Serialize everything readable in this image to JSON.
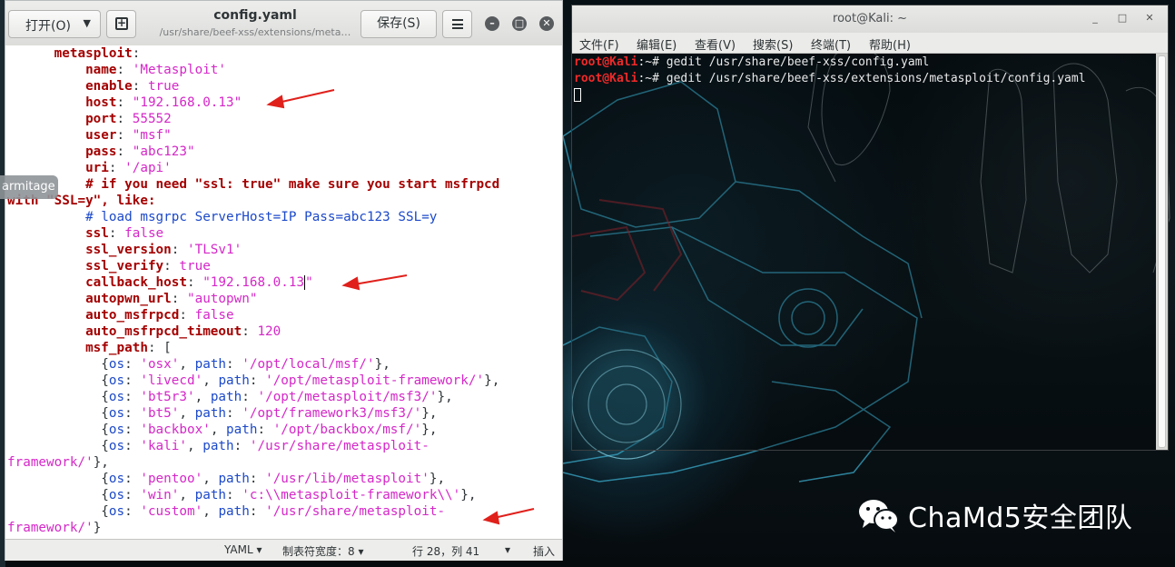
{
  "desktop": {
    "side_tag": "armitage",
    "brand": "ChaMd5安全团队"
  },
  "gedit": {
    "open_label": "打开(O)",
    "title": "config.yaml",
    "subtitle": "/usr/share/beef-xss/extensions/meta…",
    "save_label": "保存(S)",
    "status": {
      "language": "YAML",
      "tab_width": "制表符宽度：8",
      "position": "行 28，列 41",
      "mode": "插入"
    },
    "lines": {
      "l1k": "metasploit",
      "l2k": "name",
      "l2v": "'Metasploit'",
      "l3k": "enable",
      "l3v": "true",
      "l4k": "host",
      "l4v": "\"192.168.0.13\"",
      "l5k": "port",
      "l5v": "55552",
      "l6k": "user",
      "l6v": "\"msf\"",
      "l7k": "pass",
      "l7v": "\"abc123\"",
      "l8k": "uri",
      "l8v": "'/api'",
      "l9": "# if you need \"ssl: true\" make sure you start msfrpcd",
      "l10": "with \"SSL=y\", like:",
      "l11": "# load msgrpc ServerHost=IP Pass=abc123 SSL=y",
      "l12k": "ssl",
      "l12v": "false",
      "l13k": "ssl_version",
      "l13v": "'TLSv1'",
      "l14k": "ssl_verify",
      "l14v": "true",
      "l15k": "callback_host",
      "l15v": "\"192.168.0.13",
      "l15q": "\"",
      "l16k": "autopwn_url",
      "l16v": "\"autopwn\"",
      "l17k": "auto_msfrpcd",
      "l17v": "false",
      "l18k": "auto_msfrpcd_timeout",
      "l18v": "120",
      "l19k": "msf_path",
      "l19v": "[",
      "p1os": "'osx'",
      "p1path": "'/opt/local/msf/'",
      "p2os": "'livecd'",
      "p2path": "'/opt/metasploit-framework/'",
      "p3os": "'bt5r3'",
      "p3path": "'/opt/metasploit/msf3/'",
      "p4os": "'bt5'",
      "p4path": "'/opt/framework3/msf3/'",
      "p5os": "'backbox'",
      "p5path": "'/opt/backbox/msf/'",
      "p6os": "'kali'",
      "p6path": "'/usr/share/metasploit-",
      "p6cont": "framework/'",
      "p7os": "'pentoo'",
      "p7path": "'/usr/lib/metasploit'",
      "p8os": "'win'",
      "p8path": "'c:\\\\metasploit-framework\\\\'",
      "p9os": "'custom'",
      "p9path": "'/usr/share/metasploit-",
      "p9cont": "framework/'",
      "os_key": "os",
      "path_key": "path"
    }
  },
  "terminal": {
    "title": "root@Kali: ~",
    "menu": [
      "文件(F)",
      "编辑(E)",
      "查看(V)",
      "搜索(S)",
      "终端(T)",
      "帮助(H)"
    ],
    "prompt_user": "root@Kali",
    "prompt_rest": ":~# ",
    "cmd1": "gedit /usr/share/beef-xss/config.yaml",
    "cmd2": "gedit /usr/share/beef-xss/extensions/metasploit/config.yaml"
  }
}
